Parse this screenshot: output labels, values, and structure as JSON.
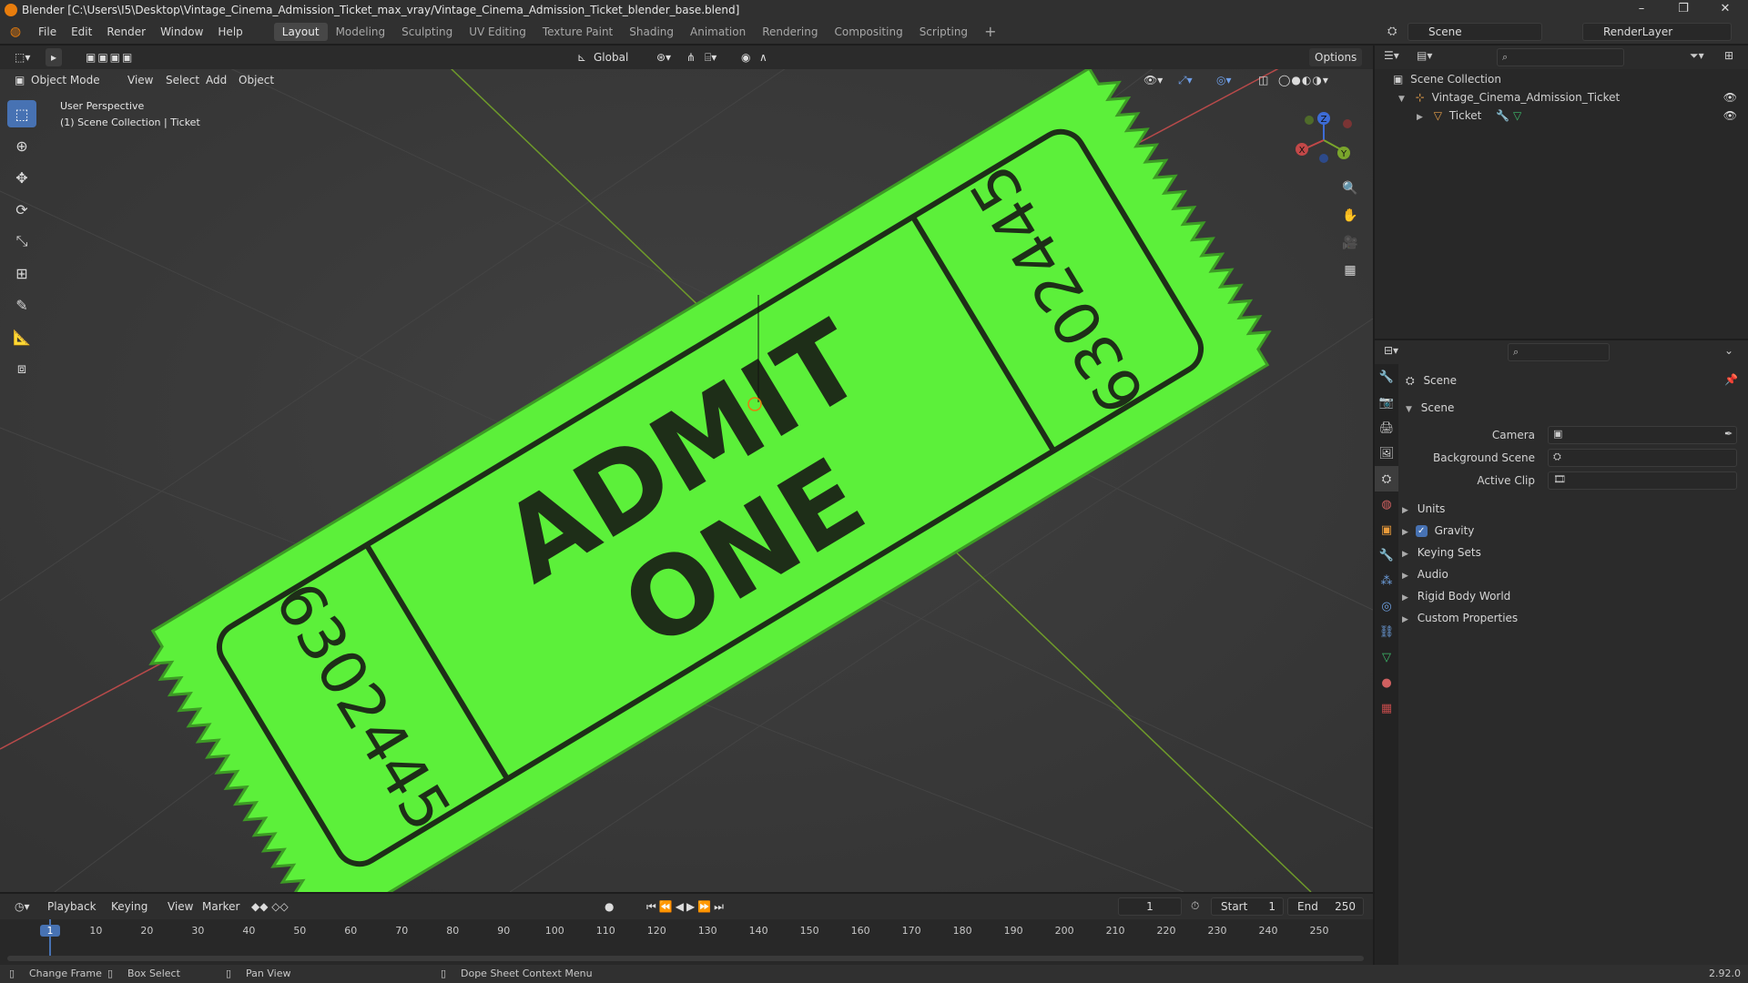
{
  "window": {
    "title": "Blender [C:\\Users\\I5\\Desktop\\Vintage_Cinema_Admission_Ticket_max_vray/Vintage_Cinema_Admission_Ticket_blender_base.blend]",
    "minimize": "–",
    "maximize": "❐",
    "close": "✕"
  },
  "menu": [
    "File",
    "Edit",
    "Render",
    "Window",
    "Help"
  ],
  "workspaces": [
    "Layout",
    "Modeling",
    "Sculpting",
    "UV Editing",
    "Texture Paint",
    "Shading",
    "Animation",
    "Rendering",
    "Compositing",
    "Scripting"
  ],
  "active_workspace": "Layout",
  "scene_selector": {
    "value": "Scene"
  },
  "renderlayer_selector": {
    "value": "RenderLayer"
  },
  "viewport_header": {
    "mode": "Object Mode",
    "menus": [
      "View",
      "Select",
      "Add",
      "Object"
    ],
    "orientation": "Global",
    "options": "Options"
  },
  "viewport_overlay": {
    "line1": "User Perspective",
    "line2": "(1) Scene Collection | Ticket"
  },
  "ticket": {
    "line1": "ADMIT",
    "line2": "ONE",
    "serial": "6302445",
    "color": "#5cf03a"
  },
  "gizmo": {
    "x": "X",
    "y": "Y",
    "z": "Z"
  },
  "outliner": {
    "root": "Scene Collection",
    "items": [
      {
        "label": "Vintage_Cinema_Admission_Ticket"
      },
      {
        "label": "Ticket"
      }
    ]
  },
  "properties": {
    "header": "Scene",
    "section": "Scene",
    "fields": [
      {
        "label": "Camera",
        "value": ""
      },
      {
        "label": "Background Scene",
        "value": ""
      },
      {
        "label": "Active Clip",
        "value": ""
      }
    ],
    "panels": [
      "Units",
      "Gravity",
      "Keying Sets",
      "Audio",
      "Rigid Body World",
      "Custom Properties"
    ],
    "gravity_checked": true
  },
  "timeline": {
    "menus": [
      "Playback",
      "Keying",
      "View",
      "Marker"
    ],
    "current_frame": "1",
    "start_label": "Start",
    "start": "1",
    "end_label": "End",
    "end": "250",
    "ticks": [
      "1",
      "10",
      "20",
      "30",
      "40",
      "50",
      "60",
      "70",
      "80",
      "90",
      "100",
      "110",
      "120",
      "130",
      "140",
      "150",
      "160",
      "170",
      "180",
      "190",
      "200",
      "210",
      "220",
      "230",
      "240",
      "250"
    ]
  },
  "statusbar": {
    "items": [
      "Change Frame",
      "Box Select",
      "Pan View",
      "Dope Sheet Context Menu"
    ],
    "version": "2.92.0"
  },
  "colors": {
    "accent": "#4772b3",
    "background": "#3a3a3a",
    "x_axis": "#c24848",
    "y_axis": "#7aa52c",
    "z_axis": "#3d6cd6"
  }
}
